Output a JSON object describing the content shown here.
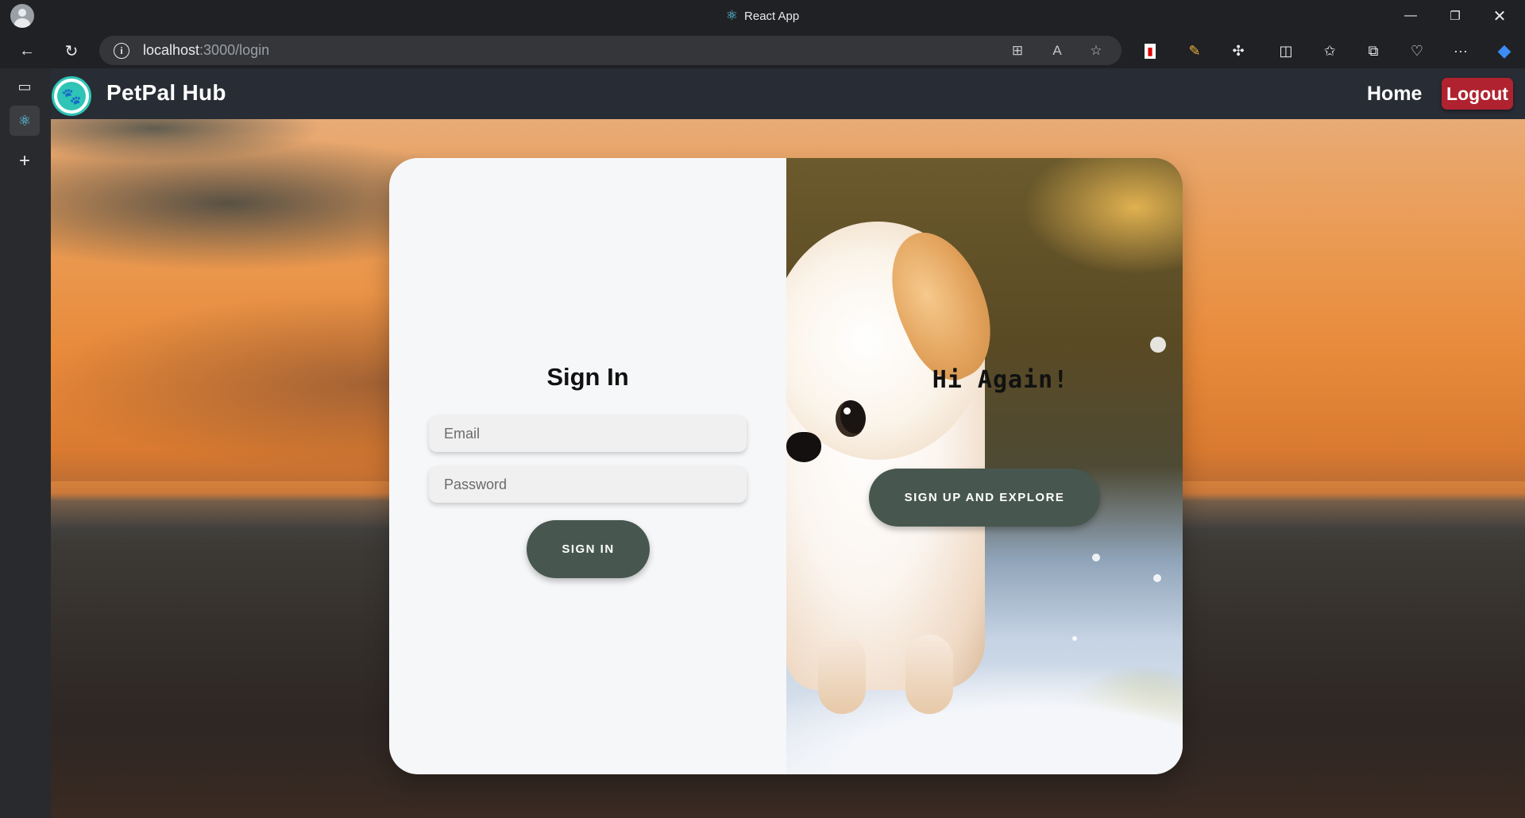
{
  "browser": {
    "window_title": "React App",
    "url_host": "localhost",
    "url_path": ":3000/login"
  },
  "app": {
    "brand": "PetPal Hub",
    "nav": {
      "home": "Home",
      "logout": "Logout"
    }
  },
  "login": {
    "title": "Sign In",
    "email_placeholder": "Email",
    "password_placeholder": "Password",
    "submit_label": "SIGN IN"
  },
  "promo": {
    "title": "Hi Again!",
    "button_label": "SIGN UP AND EXPLORE"
  },
  "colors": {
    "navbar": "#282c34",
    "logout": "#b0222f",
    "button": "#47574f",
    "logo_accent": "#2ec4b6"
  },
  "icons": {
    "omnibox": [
      "apps-icon",
      "read-aloud-icon",
      "favorite-star-icon"
    ],
    "extensions": [
      "extension-badge-icon",
      "paint-icon",
      "puzzle-icon",
      "split-screen-icon",
      "favorites-icon",
      "collections-icon",
      "health-icon",
      "more-icon",
      "copilot-icon"
    ]
  }
}
